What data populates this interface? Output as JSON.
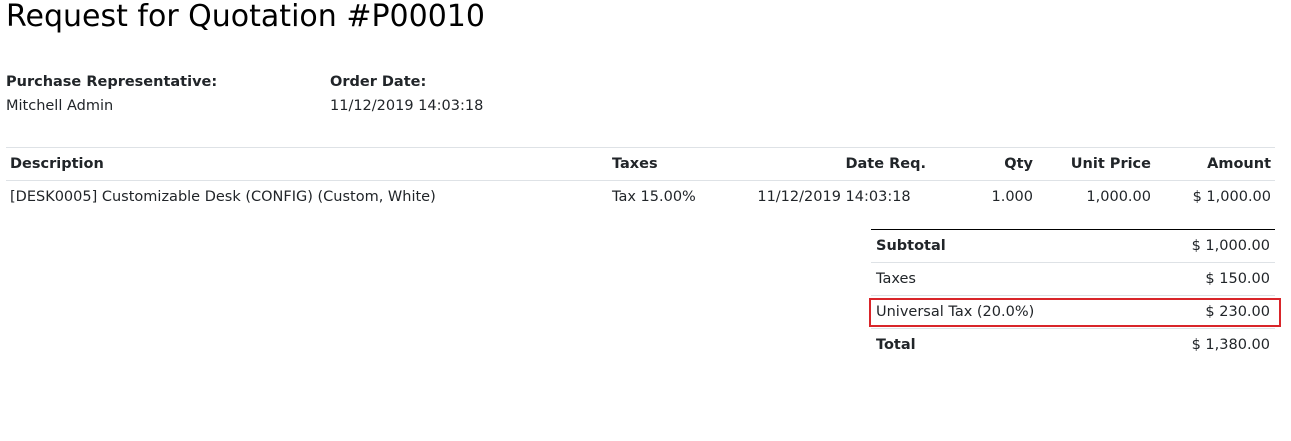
{
  "document": {
    "title": "Request for Quotation #P00010"
  },
  "info": {
    "representative_label": "Purchase Representative:",
    "representative_value": "Mitchell Admin",
    "order_date_label": "Order Date:",
    "order_date_value": "11/12/2019 14:03:18"
  },
  "lines": {
    "headers": {
      "description": "Description",
      "taxes": "Taxes",
      "date_req": "Date Req.",
      "qty": "Qty",
      "unit_price": "Unit Price",
      "amount": "Amount"
    },
    "rows": [
      {
        "description": "[DESK0005] Customizable Desk (CONFIG) (Custom, White)",
        "taxes": "Tax 15.00%",
        "date_req": "11/12/2019 14:03:18",
        "qty": "1.000",
        "unit_price": "1,000.00",
        "amount": "$ 1,000.00"
      }
    ]
  },
  "totals": {
    "subtotal_label": "Subtotal",
    "subtotal_value": "$ 1,000.00",
    "taxes_label": "Taxes",
    "taxes_value": "$ 150.00",
    "universal_label": "Universal Tax (20.0%)",
    "universal_value": "$ 230.00",
    "total_label": "Total",
    "total_value": "$ 1,380.00"
  },
  "colors": {
    "highlight": "#d9252a",
    "divider": "#dee2e6",
    "text": "#212529"
  }
}
